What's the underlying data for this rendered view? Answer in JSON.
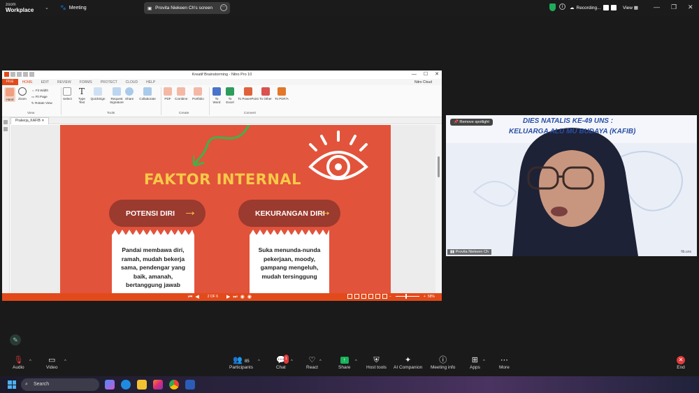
{
  "topbar": {
    "brand_line1": "zoom",
    "brand_line2": "Workplace",
    "meeting_label": "Meeting",
    "screen_share_label": "Provita Niekeen Ch's screen",
    "recording_label": "Recording...",
    "view_label": "View"
  },
  "nitro": {
    "window_title": "Kreatif Brainstorming - Nitro Pro 10",
    "menu": [
      "FILE",
      "HOME",
      "EDIT",
      "REVIEW",
      "FORMS",
      "PROTECT",
      "CLOUD",
      "HELP"
    ],
    "cloud_label": "Nitro Cloud",
    "ribbon": {
      "hand": "Hand",
      "zoom": "Zoom",
      "fit_width": "Fit Width",
      "fit_page": "Fit Page",
      "rotate_view": "Rotate View",
      "select": "Select",
      "type_text": "Type Text",
      "quicksign": "QuickSign",
      "request_signature": "Request Signature",
      "share": "Share",
      "collaborate": "Collaborate",
      "pdf": "PDF",
      "combine": "Combine",
      "portfolio": "Portfolio",
      "to_word": "To Word",
      "to_excel": "To Excel",
      "to_powerpoint": "To PowerPoint",
      "to_other": "To Other",
      "to_pdfa": "To PDF/A",
      "group_view": "View",
      "group_tools": "Tools",
      "group_create": "Create",
      "group_convert": "Convert"
    },
    "doc_tab": "Prakerja_KAFIB",
    "status": {
      "page": "2 OF 6",
      "zoom": "58%"
    }
  },
  "slide": {
    "heading": "FAKTOR INTERNAL",
    "left_pill": "POTENSI DIRI",
    "right_pill": "KEKURANGAN DIRI",
    "left_card": [
      "Pandai membawa diri,",
      "ramah, mudah bekerja",
      "sama, pendengar yang",
      "baik, amanah,",
      "bertanggung jawab"
    ],
    "right_card": [
      "Suka menunda-nunda",
      "pekerjaan, moody,",
      "gampang mengeluh,",
      "mudah tersinggung"
    ]
  },
  "video": {
    "spotlight_label": "Remove spotlight",
    "banner1": "DIES NATALIS KE-49 UNS :",
    "banner2": "KELUARGA ALU          MU BUDAYA (KAFIB)",
    "nameplate": "Provita Niekeen Ch",
    "social": "fib.uns"
  },
  "controls": {
    "audio": "Audio",
    "video": "Video",
    "participants": "Participants",
    "participants_count": "85",
    "chat": "Chat",
    "chat_badge": "1",
    "react": "React",
    "share": "Share",
    "host_tools": "Host tools",
    "ai_companion": "AI Companion",
    "meeting_info": "Meeting info",
    "apps": "Apps",
    "more": "More",
    "end": "End"
  },
  "taskbar": {
    "search_placeholder": "Search"
  },
  "colors": {
    "nitro_orange": "#e24a1b",
    "slide_bg": "#e2533b",
    "slide_heading": "#f7c948",
    "pill_bg": "#9b3a2e",
    "share_green": "#19b35b",
    "end_red": "#e23b3b"
  }
}
